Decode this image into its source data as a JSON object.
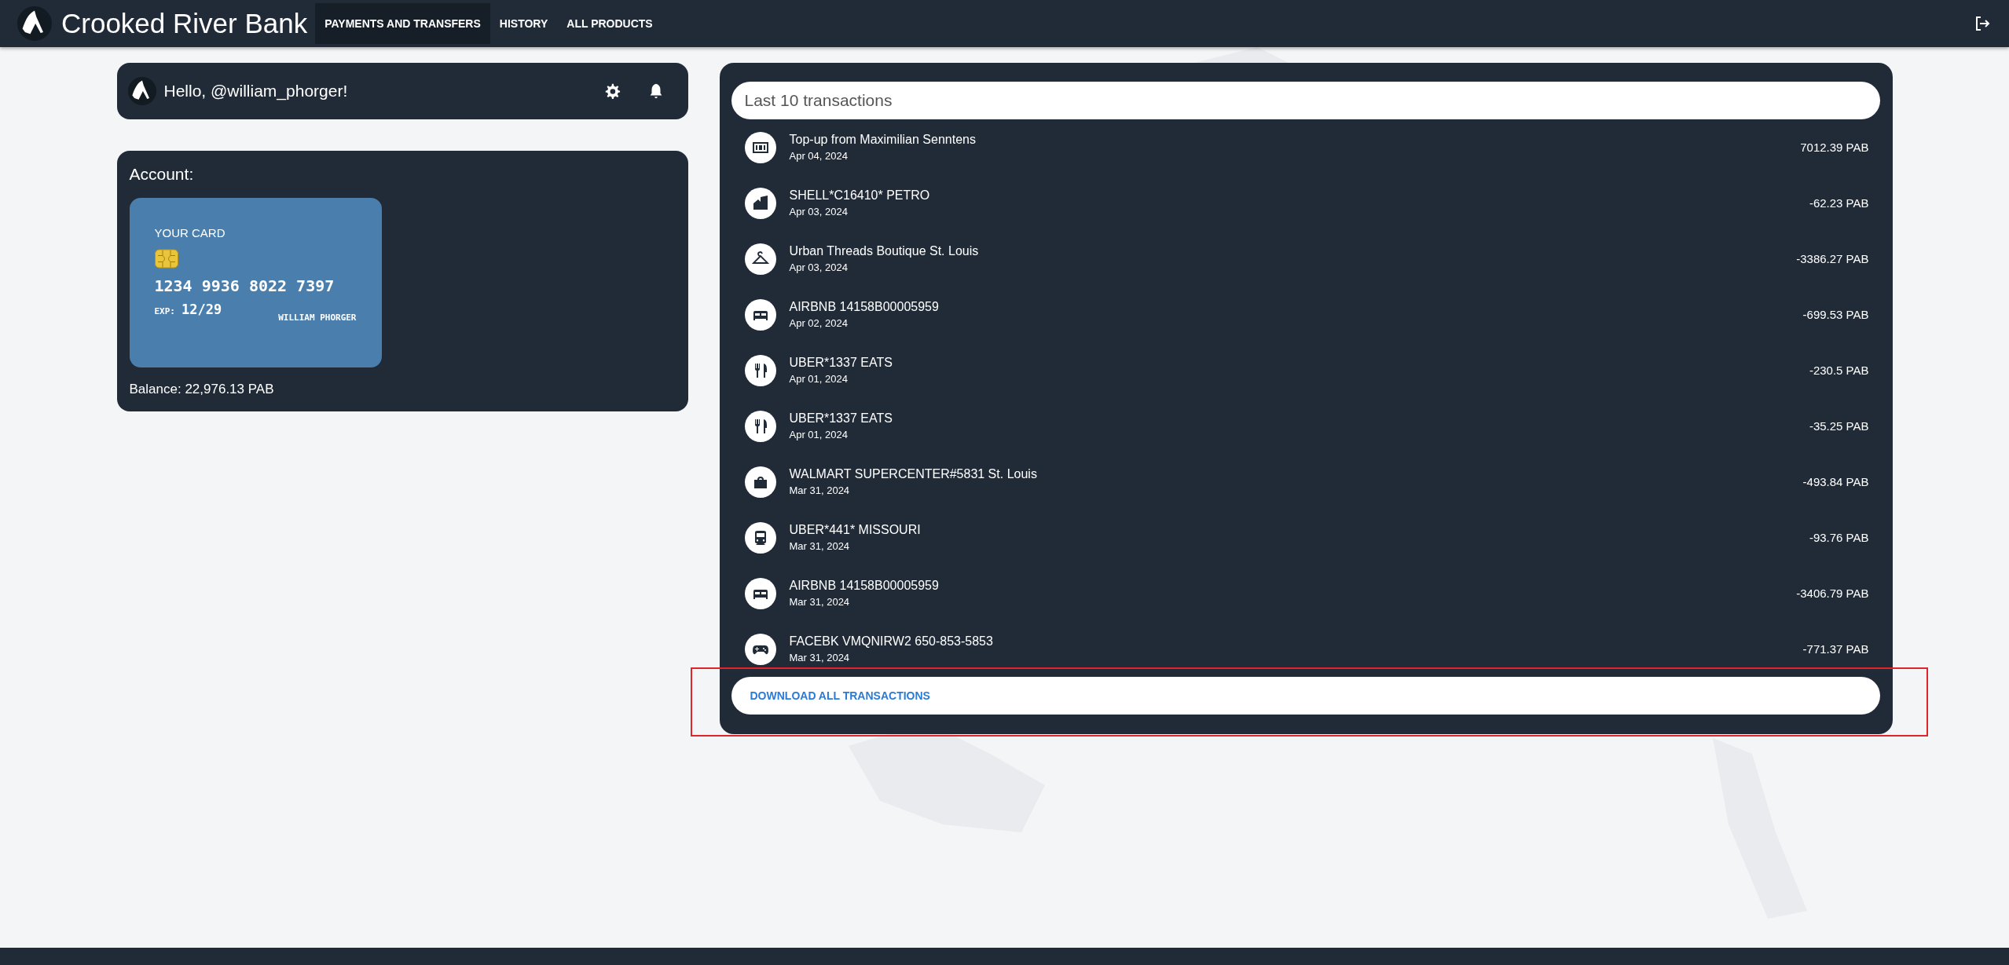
{
  "header": {
    "brand": "Crooked River Bank",
    "nav": [
      {
        "label": "PAYMENTS AND TRANSFERS",
        "selected": true
      },
      {
        "label": "HISTORY",
        "selected": false
      },
      {
        "label": "ALL PRODUCTS",
        "selected": false
      }
    ]
  },
  "greeting": "Hello, @william_phorger!",
  "account": {
    "title": "Account:",
    "card": {
      "label": "YOUR CARD",
      "number": "1234 9936 8022 7397",
      "exp_label": "EXP:",
      "exp": "12/29",
      "holder": "WILLIAM PHORGER"
    },
    "balance": "Balance: 22,976.13 PAB"
  },
  "transactions": {
    "title": "Last 10 transactions",
    "items": [
      {
        "kind": "cash",
        "name": "Top-up from Maximilian Senntens",
        "date": "Apr 04, 2024",
        "amount": "7012.39 PAB"
      },
      {
        "kind": "building",
        "name": "SHELL*C16410* PETRO",
        "date": "Apr 03, 2024",
        "amount": "-62.23 PAB"
      },
      {
        "kind": "hanger",
        "name": "Urban Threads Boutique St. Louis",
        "date": "Apr 03, 2024",
        "amount": "-3386.27 PAB"
      },
      {
        "kind": "bed",
        "name": "AIRBNB 14158B00005959",
        "date": "Apr 02, 2024",
        "amount": "-699.53 PAB"
      },
      {
        "kind": "food",
        "name": "UBER*1337 EATS",
        "date": "Apr 01, 2024",
        "amount": "-230.5 PAB"
      },
      {
        "kind": "food",
        "name": "UBER*1337 EATS",
        "date": "Apr 01, 2024",
        "amount": "-35.25 PAB"
      },
      {
        "kind": "bag",
        "name": "WALMART SUPERCENTER#5831 St. Louis",
        "date": "Mar 31, 2024",
        "amount": "-493.84 PAB"
      },
      {
        "kind": "train",
        "name": "UBER*441* MISSOURI",
        "date": "Mar 31, 2024",
        "amount": "-93.76 PAB"
      },
      {
        "kind": "bed",
        "name": "AIRBNB 14158B00005959",
        "date": "Mar 31, 2024",
        "amount": "-3406.79 PAB"
      },
      {
        "kind": "gamepad",
        "name": "FACEBK VMQNIRW2 650-853-5853",
        "date": "Mar 31, 2024",
        "amount": "-771.37 PAB"
      }
    ],
    "download": "DOWNLOAD ALL TRANSACTIONS"
  }
}
